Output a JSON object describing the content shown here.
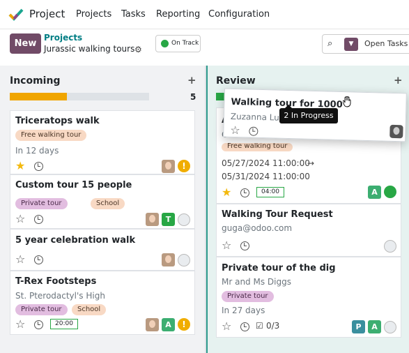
{
  "nav": {
    "app_name": "Project",
    "menu": [
      "Projects",
      "Tasks",
      "Reporting",
      "Configuration"
    ]
  },
  "control": {
    "new_label": "New",
    "breadcrumb_link": "Projects",
    "breadcrumb_current": "Jurassic walking tours",
    "status": "On Track",
    "search_facet": "Open Tasks"
  },
  "columns": [
    {
      "title": "Incoming",
      "count": "5",
      "progress": 0.41,
      "progress_color": "#f0a500"
    },
    {
      "title": "Review",
      "progress": 0.3,
      "progress_color": "#28a745"
    }
  ],
  "incoming_cards": [
    {
      "title": "Triceratops walk",
      "tags": [
        "Free walking tour"
      ],
      "due": "In 12 days",
      "starred": true
    },
    {
      "title": "Custom tour 15 people",
      "tags": [
        "Private tour",
        "School"
      ],
      "avatar_letter": "T"
    },
    {
      "title": "5 year celebration walk"
    },
    {
      "title": "T-Rex Footsteps",
      "subtitle": "St. Pterodactyl's High",
      "tags": [
        "Private tour",
        "School"
      ],
      "time": "20:00",
      "avatar_letter": "A"
    }
  ],
  "review_cards": [
    {
      "title_partial": "A",
      "sub_partial": "C",
      "tag_partial": "Free walking tour",
      "date_start": "05/27/2024 11:00:00",
      "arrow": "→",
      "date_end": "05/31/2024 11:00:00",
      "time": "04:00",
      "avatar_letter": "A",
      "starred": true
    },
    {
      "title": "Walking Tour Request",
      "subtitle": "guga@odoo.com"
    },
    {
      "title": "Private tour of the dig",
      "subtitle": "Mr and Ms Diggs",
      "tags": [
        "Private tour"
      ],
      "due": "In 27 days",
      "subtasks": "0/3",
      "avatar_letters": [
        "P",
        "A"
      ]
    }
  ],
  "dragged_card": {
    "title": "Walking tour for 1000",
    "subtitle": "Zuzanna Luc"
  },
  "tooltip": "2 In Progress",
  "colors": {
    "brand": "#714b67",
    "teal": "#017e84",
    "green": "#28a745",
    "warning": "#f0ad00",
    "avatar_t": "#28a745",
    "avatar_a": "#3cae71",
    "avatar_p": "#3a8f9e"
  }
}
